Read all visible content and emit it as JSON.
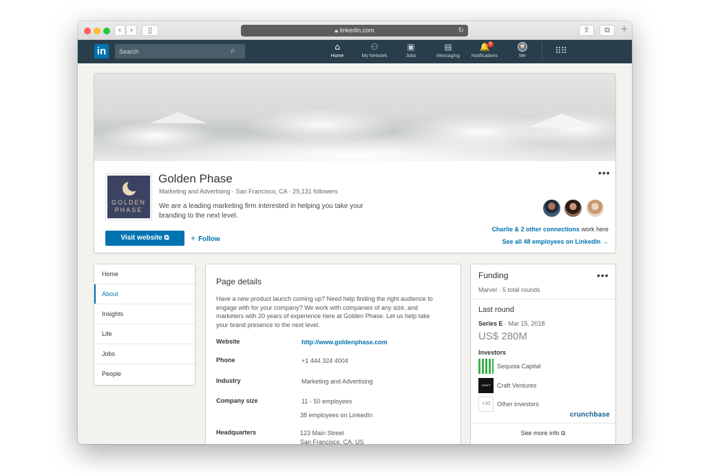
{
  "browser": {
    "url": "linkedin.com",
    "back": "‹",
    "forward": "›",
    "sidebar_icon": "▯",
    "share_icon": "⇪",
    "tabs_icon": "⧉",
    "new_tab": "+",
    "reload_icon": "↻"
  },
  "nav": {
    "logo": "in",
    "search_placeholder": "Search",
    "items": [
      {
        "label": "Home",
        "icon": "⌂",
        "active": true
      },
      {
        "label": "My Network",
        "icon": "⚇"
      },
      {
        "label": "Jobs",
        "icon": "▣"
      },
      {
        "label": "Messaging",
        "icon": "▤"
      },
      {
        "label": "Notifications",
        "icon": "🔔",
        "badge": "8"
      },
      {
        "label": "Me",
        "icon": ""
      }
    ],
    "apps_icon": "⠿⠿"
  },
  "company": {
    "name": "Golden Phase",
    "logo_text_line1": "GOLDEN",
    "logo_text_line2": "PHASE",
    "meta": "Marketing and Advertising · San Francisco, CA · 29,131 followers",
    "description": "We are a leading marketing firm interested in helping you take your branding to the next level.",
    "visit_label": "Visit website ⧉",
    "follow_label": "Follow",
    "more": "•••",
    "connections_link": "Charlie & 2 other connections",
    "connections_suffix": " work here",
    "see_all": "See all 48 employees on LinkedIn →"
  },
  "leftnav": {
    "items": [
      "Home",
      "About",
      "Insights",
      "Life",
      "Jobs",
      "People"
    ],
    "active_index": 1
  },
  "details": {
    "title": "Page details",
    "about": "Have a new product launch coming up? Need help finding the right audience to engage with for your company? We work with companies of any size, and marketers with 20 years of experience here at Golden Phase. Let us help take your brand presence to the next level.",
    "rows": [
      {
        "label": "Website",
        "value": "http://www.goldenphase.com",
        "link": true
      },
      {
        "label": "Phone",
        "value": "+1 444 324 4004"
      },
      {
        "label": "Industry",
        "value": "Marketing and Advertising"
      },
      {
        "label": "Company size",
        "value": "11 - 50 employees",
        "value2": "38 employees on LinkedIn"
      },
      {
        "label": "Headquarters",
        "value": "123 Main Street",
        "value2": "San Francisco, CA, US"
      }
    ]
  },
  "funding": {
    "title": "Funding",
    "more": "•••",
    "sub": "Marvel · 5 total rounds",
    "last_round": "Last round",
    "series": "Series E",
    "series_date": " · Mar 15, 2018",
    "amount": "US$ 280M",
    "investors_label": "Investors",
    "investors": [
      {
        "name": "Sequoia Capital",
        "logo": ""
      },
      {
        "name": "Craft Ventures",
        "logo": "CRAFT"
      },
      {
        "name": "Other investors",
        "logo": "+10"
      }
    ],
    "source": "crunchbase",
    "see_more": "See more info ⧉"
  }
}
